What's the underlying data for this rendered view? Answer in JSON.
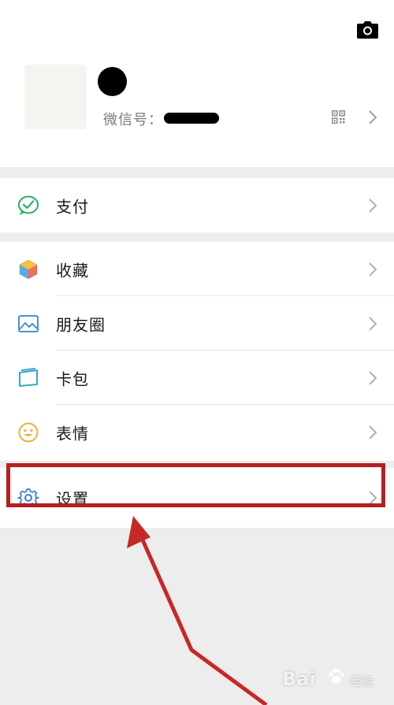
{
  "profile": {
    "wechat_id_label": "微信号："
  },
  "menu": {
    "pay": {
      "label": "支付",
      "icon": "wallet-check-icon"
    },
    "favorites": {
      "label": "收藏",
      "icon": "cube-icon"
    },
    "moments": {
      "label": "朋友圈",
      "icon": "image-icon"
    },
    "cards": {
      "label": "卡包",
      "icon": "card-icon"
    },
    "stickers": {
      "label": "表情",
      "icon": "smiley-icon"
    },
    "settings": {
      "label": "设置",
      "icon": "gear-icon"
    }
  },
  "annotation": {
    "highlight_color": "#b52020",
    "watermark_brand": "Bai",
    "watermark_sub": "经验"
  },
  "colors": {
    "background": "#ededed",
    "surface": "#ffffff",
    "pay_green": "#2aae67",
    "settings_blue": "#3b7ad9"
  }
}
